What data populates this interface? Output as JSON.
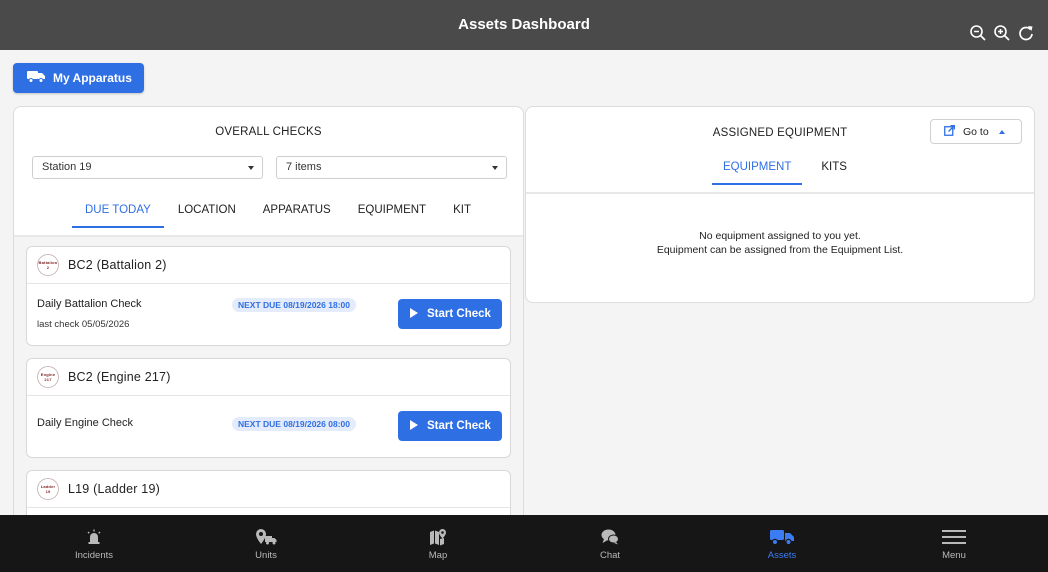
{
  "window": {
    "title": "Assets Dashboard"
  },
  "toolbar": {
    "my_apparatus_label": "My Apparatus"
  },
  "checks": {
    "heading": "OVERALL CHECKS",
    "station_select": "Station 19",
    "items_select": "7 items",
    "tabs": [
      "DUE TODAY",
      "LOCATION",
      "APPARATUS",
      "EQUIPMENT",
      "KIT"
    ],
    "active_tab": "DUE TODAY",
    "cards": [
      {
        "logo_top": "Battalion",
        "logo_bottom": "2",
        "title": "BC2 (Battalion 2)",
        "check_name": "Daily Battalion Check",
        "last_check": "last check 05/05/2026",
        "next_due": "NEXT DUE 08/19/2026 18:00",
        "button": "Start Check"
      },
      {
        "logo_top": "Engine",
        "logo_bottom": "217",
        "title": "BC2 (Engine 217)",
        "check_name": "Daily Engine Check",
        "last_check": "",
        "next_due": "NEXT DUE 08/19/2026 08:00",
        "button": "Start Check"
      },
      {
        "logo_top": "Ladder",
        "logo_bottom": "19",
        "title": "L19 (Ladder 19)"
      }
    ]
  },
  "equipment": {
    "heading": "ASSIGNED EQUIPMENT",
    "goto_label": "Go to",
    "tabs": [
      "EQUIPMENT",
      "KITS"
    ],
    "active_tab": "EQUIPMENT",
    "empty_line1": "No equipment assigned to you yet.",
    "empty_line2": "Equipment can be assigned from the Equipment List."
  },
  "nav": {
    "items": [
      {
        "label": "Incidents",
        "icon": "siren-icon"
      },
      {
        "label": "Units",
        "icon": "units-icon"
      },
      {
        "label": "Map",
        "icon": "map-icon"
      },
      {
        "label": "Chat",
        "icon": "chat-icon"
      },
      {
        "label": "Assets",
        "icon": "truck-icon"
      },
      {
        "label": "Menu",
        "icon": "hamburger-icon"
      }
    ],
    "active": "Assets"
  },
  "colors": {
    "accent": "#2f6fe4",
    "titlebar": "#4a4a4a",
    "navbar": "#161616"
  }
}
